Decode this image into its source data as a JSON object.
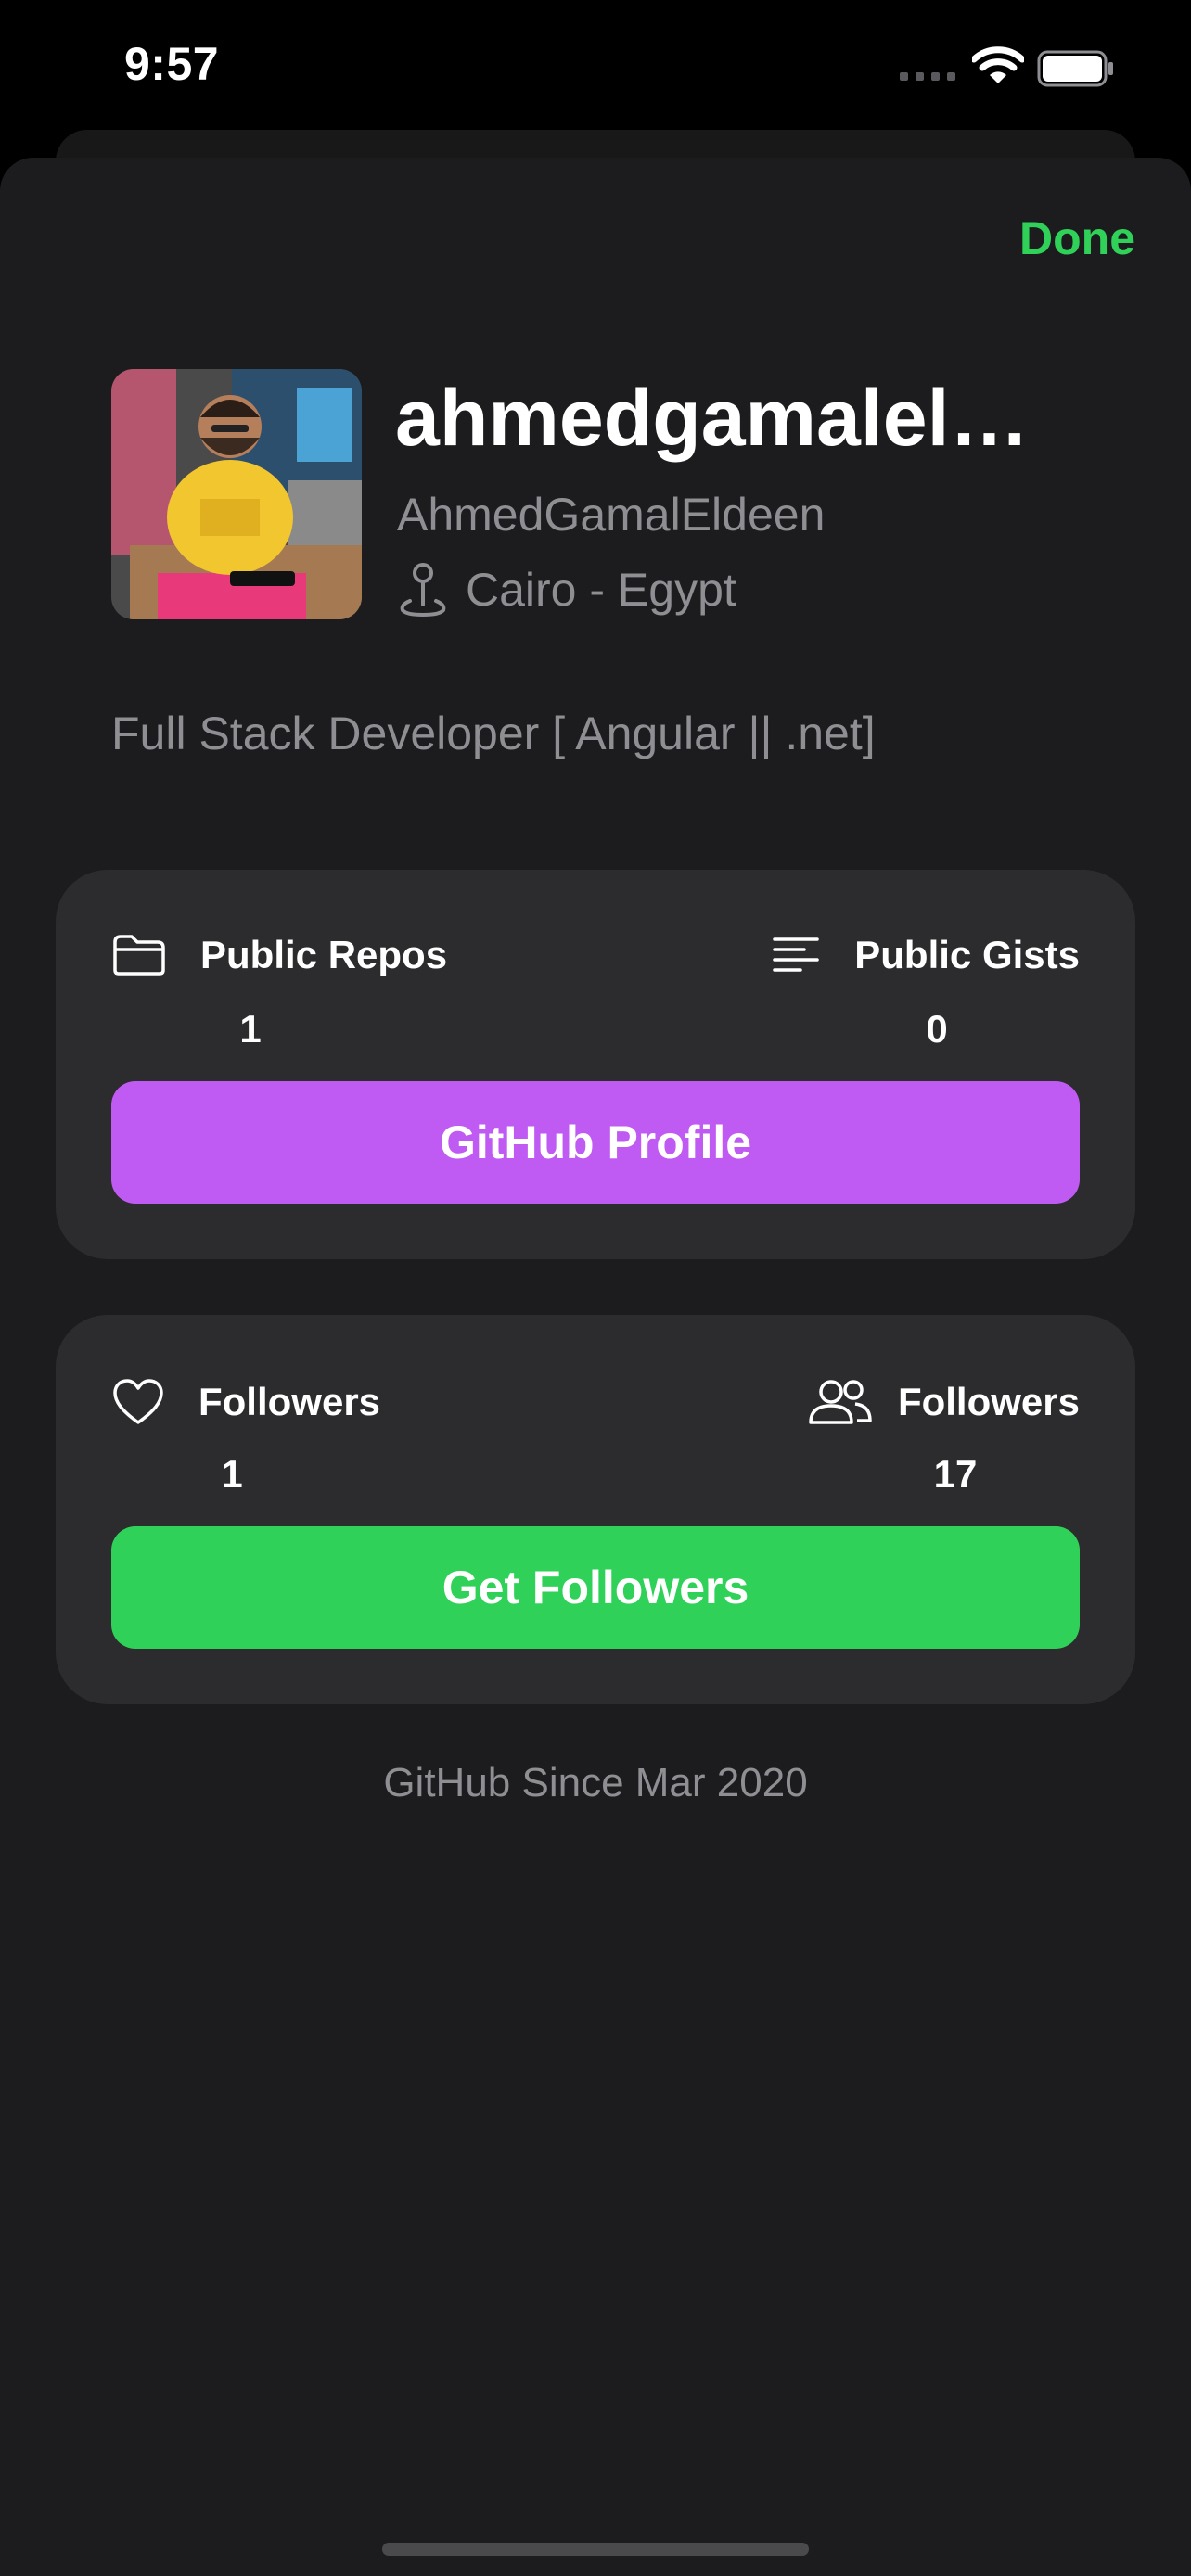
{
  "status_bar": {
    "time": "9:57"
  },
  "header": {
    "done_label": "Done"
  },
  "profile": {
    "username": "ahmedgamaleldeen",
    "display_name": "AhmedGamalEldeen",
    "location": "Cairo - Egypt",
    "bio": "Full Stack Developer [ Angular || .net]"
  },
  "repos_card": {
    "left_label": "Public Repos",
    "left_value": "1",
    "right_label": "Public Gists",
    "right_value": "0",
    "button_label": "GitHub Profile"
  },
  "followers_card": {
    "left_label": "Followers",
    "left_value": "1",
    "right_label": "Followers",
    "right_value": "17",
    "button_label": "Get Followers"
  },
  "footer": {
    "since": "GitHub Since Mar 2020"
  },
  "colors": {
    "accent_green": "#30d158",
    "accent_purple": "#bf5af2",
    "sheet_background": "#1c1c1e",
    "card_background": "#2c2c2e",
    "secondary_text": "#8e8e93"
  },
  "icons": [
    "wifi-icon",
    "battery-icon",
    "location-pin-icon",
    "folder-icon",
    "text-align-left-icon",
    "heart-icon",
    "person-2-icon"
  ]
}
